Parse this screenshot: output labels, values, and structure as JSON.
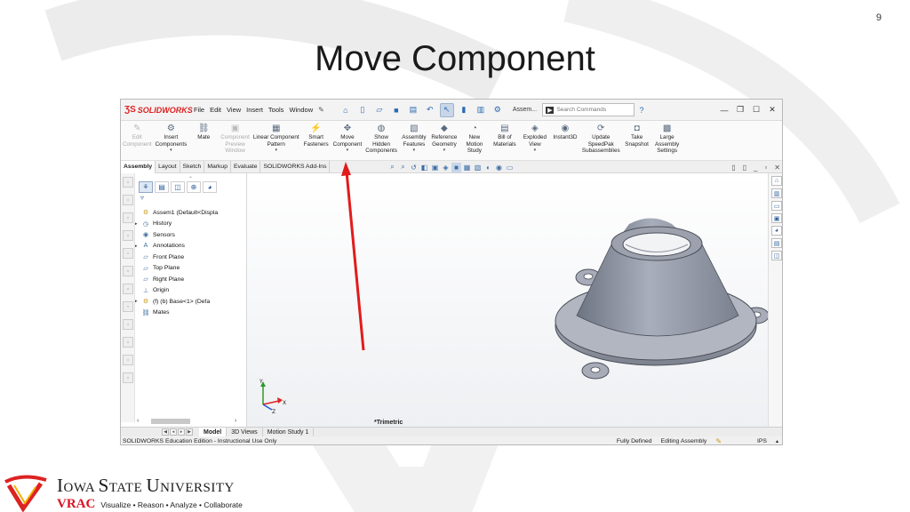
{
  "slide": {
    "number": "9",
    "title": "Move Component"
  },
  "solidworks": {
    "logo": "SOLIDWORKS",
    "menus": [
      "File",
      "Edit",
      "View",
      "Insert",
      "Tools",
      "Window"
    ],
    "doc_name": "Assem...",
    "search_placeholder": "Search Commands",
    "ribbon": [
      {
        "label": "Edit\nComponent",
        "disabled": true
      },
      {
        "label": "Insert\nComponents",
        "caret": true
      },
      {
        "label": "Mate"
      },
      {
        "label": "Component\nPreview\nWindow",
        "disabled": true
      },
      {
        "label": "Linear Component\nPattern",
        "caret": true
      },
      {
        "label": "Smart\nFasteners"
      },
      {
        "label": "Move\nComponent",
        "caret": true
      },
      {
        "label": "Show\nHidden\nComponents"
      },
      {
        "label": "Assembly\nFeatures",
        "caret": true
      },
      {
        "label": "Reference\nGeometry",
        "caret": true
      },
      {
        "label": "New\nMotion\nStudy"
      },
      {
        "label": "Bill of\nMaterials"
      },
      {
        "label": "Exploded\nView",
        "caret": true
      },
      {
        "label": "Instant3D"
      },
      {
        "label": "Update\nSpeedPak\nSubassemblies"
      },
      {
        "label": "Take\nSnapshot"
      },
      {
        "label": "Large\nAssembly\nSettings"
      }
    ],
    "command_tabs": [
      "Assembly",
      "Layout",
      "Sketch",
      "Markup",
      "Evaluate",
      "SOLIDWORKS Add-Ins"
    ],
    "tree": [
      {
        "label": "Assem1  (Default<Displa",
        "arrow": false,
        "icon": "assembly-icon"
      },
      {
        "label": "History",
        "arrow": true,
        "icon": "history-icon"
      },
      {
        "label": "Sensors",
        "arrow": false,
        "icon": "sensor-icon"
      },
      {
        "label": "Annotations",
        "arrow": true,
        "icon": "annotation-icon"
      },
      {
        "label": "Front Plane",
        "arrow": false,
        "icon": "plane-icon"
      },
      {
        "label": "Top Plane",
        "arrow": false,
        "icon": "plane-icon"
      },
      {
        "label": "Right Plane",
        "arrow": false,
        "icon": "plane-icon"
      },
      {
        "label": "Origin",
        "arrow": false,
        "icon": "origin-icon"
      },
      {
        "label": "(f) (b) Base<1> (Defa",
        "arrow": true,
        "icon": "part-icon"
      },
      {
        "label": "Mates",
        "arrow": false,
        "icon": "mates-icon"
      }
    ],
    "view_label": "*Trimetric",
    "bottom_tabs": [
      "Model",
      "3D Views",
      "Motion Study 1"
    ],
    "status": {
      "left": "SOLIDWORKS Education Edition - Instructional Use Only",
      "defined": "Fully Defined",
      "mode": "Editing Assembly",
      "units": "IPS"
    }
  },
  "footer": {
    "university_first": "I",
    "university_rest": "OWA ",
    "university_s": "S",
    "university_tate": "TATE ",
    "university_u": "U",
    "university_niv": "NIVERSITY",
    "vrac": "VRAC",
    "tagline": "Visualize • Reason • Analyze • Collaborate"
  }
}
